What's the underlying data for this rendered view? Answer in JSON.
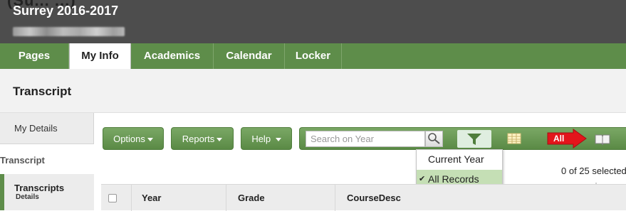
{
  "header": {
    "top_cut_text": "(Su... ...)",
    "school_title": "Surrey 2016-2017",
    "user_name": "Redacted user name"
  },
  "nav": {
    "tabs": [
      {
        "label": "Pages",
        "active": false
      },
      {
        "label": "My Info",
        "active": true
      },
      {
        "label": "Academics",
        "active": false
      },
      {
        "label": "Calendar",
        "active": false
      },
      {
        "label": "Locker",
        "active": false
      }
    ]
  },
  "page": {
    "title": "Transcript"
  },
  "sidebar": {
    "my_details": "My Details",
    "section_label": "Transcript",
    "sub_label": "Transcripts",
    "sub_detail": "Details"
  },
  "toolbar": {
    "options": "Options",
    "reports": "Reports",
    "help": "Help",
    "search_placeholder": "Search on Year",
    "all_badge": "All"
  },
  "filter_menu": {
    "items": [
      {
        "label": "Current Year",
        "selected": false
      },
      {
        "label": "All Records",
        "selected": true
      }
    ]
  },
  "table": {
    "selected_count": "0 of 25 selected",
    "columns": [
      "Year",
      "Grade",
      "CourseDesc"
    ]
  },
  "colors": {
    "header_bg": "#4d4d4d",
    "nav_green": "#5e8d4a",
    "button_green": "#6a9a55",
    "selected_menu_bg": "#c5dfb5",
    "all_badge_red": "#e3151b"
  }
}
